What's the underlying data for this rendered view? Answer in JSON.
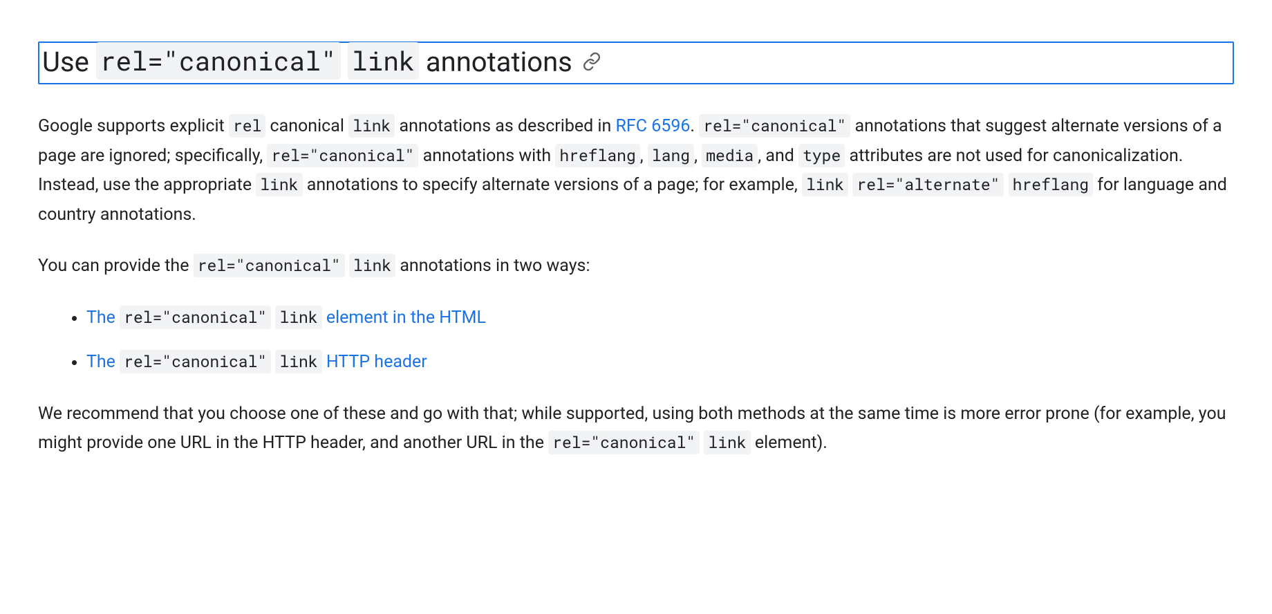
{
  "heading": {
    "pre": "Use ",
    "code1": "rel=\"canonical\"",
    "mid": " ",
    "code2": "link",
    "post": " annotations"
  },
  "p1": {
    "t1": "Google supports explicit ",
    "c1": "rel",
    "t2": " canonical ",
    "c2": "link",
    "t3": " annotations as described in ",
    "link1": "RFC 6596",
    "t4": ". ",
    "c3": "rel=\"canonical\"",
    "t5": " annotations that suggest alternate versions of a page are ignored; specifically, ",
    "c4": "rel=\"canonical\"",
    "t6": " annotations with ",
    "c5": "hreflang",
    "t7": ", ",
    "c6": "lang",
    "t8": ", ",
    "c7": "media",
    "t9": ", and ",
    "c8": "type",
    "t10": " attributes are not used for canonicalization. Instead, use the appropriate ",
    "c9": "link",
    "t11": " annotations to specify alternate versions of a page; for example, ",
    "c10": "link",
    "t12": " ",
    "c11": "rel=\"alternate\"",
    "t13": " ",
    "link2": "hreflang",
    "t14": " for language and country annotations."
  },
  "p2": {
    "t1": "You can provide the ",
    "c1": "rel=\"canonical\"",
    "t2": " ",
    "c2": "link",
    "t3": " annotations in two ways:"
  },
  "list": {
    "item1": {
      "pre": "The ",
      "c1": "rel=\"canonical\"",
      "mid": " ",
      "c2": "link",
      "post": " element in the HTML"
    },
    "item2": {
      "pre": "The ",
      "c1": "rel=\"canonical\"",
      "mid": " ",
      "c2": "link",
      "post": " HTTP header"
    }
  },
  "p3": {
    "t1": "We recommend that you choose one of these and go with that; while supported, using both methods at the same time is more error prone (for example, you might provide one URL in the HTTP header, and another URL in the ",
    "c1": "rel=\"canonical\"",
    "t2": " ",
    "c2": "link",
    "t3": " element)."
  }
}
